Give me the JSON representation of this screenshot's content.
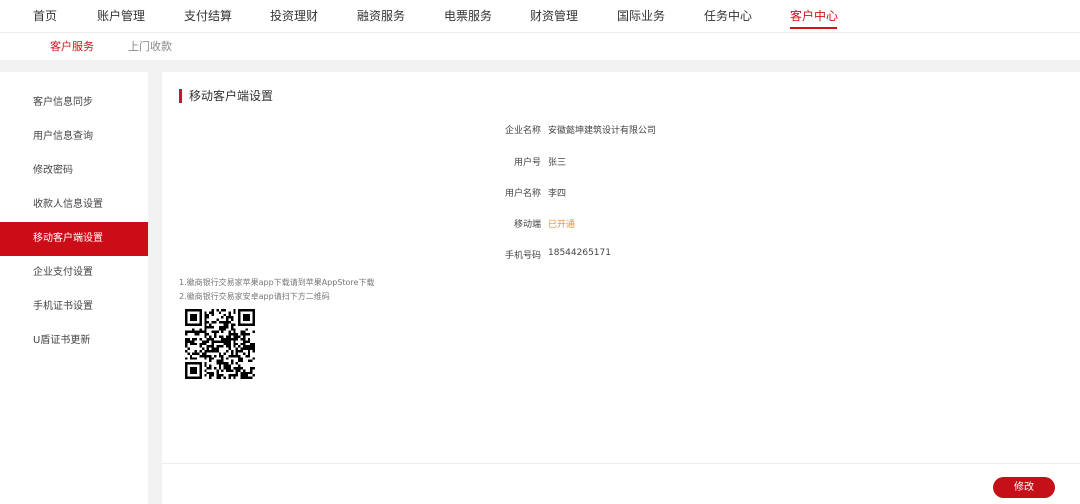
{
  "top_nav": {
    "items": [
      "首页",
      "账户管理",
      "支付结算",
      "投资理财",
      "融资服务",
      "电票服务",
      "财资管理",
      "国际业务",
      "任务中心",
      "客户中心"
    ],
    "active_index": 9
  },
  "sub_nav": {
    "items": [
      "客户服务",
      "上门收款"
    ],
    "active_index": 0
  },
  "sidebar": {
    "items": [
      "客户信息同步",
      "用户信息查询",
      "修改密码",
      "收款人信息设置",
      "移动客户端设置",
      "企业支付设置",
      "手机证书设置",
      "U盾证书更新"
    ],
    "active_index": 4
  },
  "main": {
    "title": "移动客户端设置",
    "fields": [
      {
        "label": "企业名称",
        "value": "安徽懿坤建筑设计有限公司"
      },
      {
        "label": "用户号",
        "value": "张三"
      },
      {
        "label": "用户名称",
        "value": "李四"
      },
      {
        "label": "移动端",
        "value": "已开通"
      },
      {
        "label": "手机号码",
        "value": "18544265171"
      }
    ],
    "notes": [
      "1.徽商银行交易家苹果app下载请到苹果AppStore下载",
      "2.徽商银行交易家安卓app请扫下方二维码"
    ],
    "edit_button": "修改"
  },
  "colors": {
    "accent": "#cc0d17",
    "status_open": "#f08a3a",
    "page_bg": "#f2f2f2"
  }
}
